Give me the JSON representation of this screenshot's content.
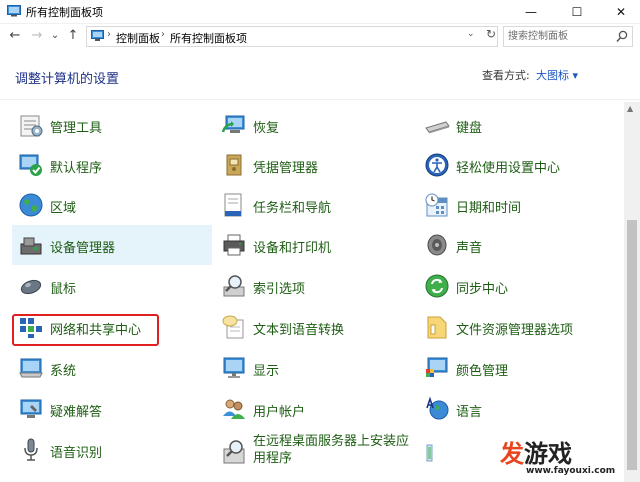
{
  "window": {
    "title": "所有控制面板项",
    "minimize_glyph": "—",
    "maximize_glyph": "☐",
    "close_glyph": "✕"
  },
  "nav": {
    "back_glyph": "←",
    "forward_glyph": "→",
    "recent_glyph": "⌄",
    "up_glyph": "↑",
    "breadcrumbs": [
      "控制面板",
      "所有控制面板项"
    ],
    "separator": "›",
    "dropdown_glyph": "⌄",
    "refresh_glyph": "↻",
    "search_placeholder": "搜索控制面板"
  },
  "header": {
    "title": "调整计算机的设置",
    "view_label": "查看方式:",
    "view_value": "大图标 ▾"
  },
  "items": [
    {
      "label": "管理工具",
      "icon": "admin-tools-icon"
    },
    {
      "label": "恢复",
      "icon": "recovery-icon"
    },
    {
      "label": "键盘",
      "icon": "keyboard-icon"
    },
    {
      "label": "默认程序",
      "icon": "default-programs-icon"
    },
    {
      "label": "凭据管理器",
      "icon": "credential-manager-icon"
    },
    {
      "label": "轻松使用设置中心",
      "icon": "ease-of-access-icon"
    },
    {
      "label": "区域",
      "icon": "region-globe-icon"
    },
    {
      "label": "任务栏和导航",
      "icon": "taskbar-icon"
    },
    {
      "label": "日期和时间",
      "icon": "date-time-icon"
    },
    {
      "label": "设备管理器",
      "icon": "device-manager-icon"
    },
    {
      "label": "设备和打印机",
      "icon": "printer-icon"
    },
    {
      "label": "声音",
      "icon": "speaker-icon"
    },
    {
      "label": "鼠标",
      "icon": "mouse-icon"
    },
    {
      "label": "索引选项",
      "icon": "indexing-icon"
    },
    {
      "label": "同步中心",
      "icon": "sync-icon"
    },
    {
      "label": "网络和共享中心",
      "icon": "network-icon"
    },
    {
      "label": "文本到语音转换",
      "icon": "text-to-speech-icon"
    },
    {
      "label": "文件资源管理器选项",
      "icon": "folder-options-icon"
    },
    {
      "label": "系统",
      "icon": "system-icon"
    },
    {
      "label": "显示",
      "icon": "display-icon"
    },
    {
      "label": "颜色管理",
      "icon": "color-management-icon"
    },
    {
      "label": "疑难解答",
      "icon": "troubleshooting-icon"
    },
    {
      "label": "用户帐户",
      "icon": "user-accounts-icon"
    },
    {
      "label": "语言",
      "icon": "language-icon"
    },
    {
      "label": "语音识别",
      "icon": "microphone-icon"
    },
    {
      "label": "在远程桌面服务器上安装应用程序",
      "icon": "remote-install-icon"
    },
    {
      "label": "",
      "icon": "partial-item-icon"
    }
  ],
  "watermark": {
    "fa": "发",
    "rest": "游戏",
    "url": "www.fayouxi.com"
  },
  "colors": {
    "title_blue": "#1e3287",
    "link_green": "#1e5d14",
    "hover_bg": "#e5f3fb",
    "annotation_red": "#e02020"
  }
}
